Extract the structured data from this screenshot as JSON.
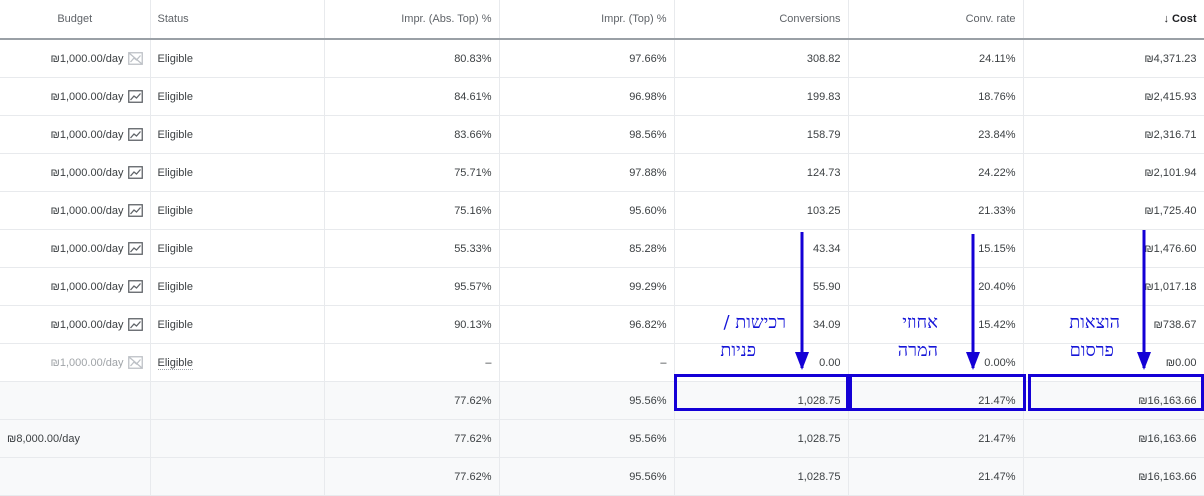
{
  "headers": {
    "budget": "Budget",
    "status": "Status",
    "impr_abs_top": "Impr. (Abs. Top) %",
    "impr_top": "Impr. (Top) %",
    "conversions": "Conversions",
    "conv_rate": "Conv. rate",
    "cost": "Cost",
    "cost_sort_icon": "↓"
  },
  "rows": [
    {
      "budget": "₪1,000.00/day",
      "chart": "paused",
      "status": "Eligible",
      "abs": "80.83%",
      "top": "97.66%",
      "conv": "308.82",
      "rate": "24.11%",
      "cost": "₪4,371.23"
    },
    {
      "budget": "₪1,000.00/day",
      "chart": "trend",
      "status": "Eligible",
      "abs": "84.61%",
      "top": "96.98%",
      "conv": "199.83",
      "rate": "18.76%",
      "cost": "₪2,415.93"
    },
    {
      "budget": "₪1,000.00/day",
      "chart": "trend",
      "status": "Eligible",
      "abs": "83.66%",
      "top": "98.56%",
      "conv": "158.79",
      "rate": "23.84%",
      "cost": "₪2,316.71"
    },
    {
      "budget": "₪1,000.00/day",
      "chart": "trend",
      "status": "Eligible",
      "abs": "75.71%",
      "top": "97.88%",
      "conv": "124.73",
      "rate": "24.22%",
      "cost": "₪2,101.94"
    },
    {
      "budget": "₪1,000.00/day",
      "chart": "trend",
      "status": "Eligible",
      "abs": "75.16%",
      "top": "95.60%",
      "conv": "103.25",
      "rate": "21.33%",
      "cost": "₪1,725.40"
    },
    {
      "budget": "₪1,000.00/day",
      "chart": "trend",
      "status": "Eligible",
      "abs": "55.33%",
      "top": "85.28%",
      "conv": "43.34",
      "rate": "15.15%",
      "cost": "₪1,476.60"
    },
    {
      "budget": "₪1,000.00/day",
      "chart": "trend",
      "status": "Eligible",
      "abs": "95.57%",
      "top": "99.29%",
      "conv": "55.90",
      "rate": "20.40%",
      "cost": "₪1,017.18"
    },
    {
      "budget": "₪1,000.00/day",
      "chart": "trend",
      "status": "Eligible",
      "abs": "90.13%",
      "top": "96.82%",
      "conv": "34.09",
      "rate": "15.42%",
      "cost": "₪738.67"
    },
    {
      "budget": "₪1,000.00/day",
      "chart": "paused",
      "status": "Eligible",
      "abs": "–",
      "top": "–",
      "conv": "0.00",
      "rate": "0.00%",
      "cost": "₪0.00",
      "dim": true
    }
  ],
  "summaries": [
    {
      "budget": "",
      "abs": "77.62%",
      "top": "95.56%",
      "conv": "1,028.75",
      "rate": "21.47%",
      "cost": "₪16,163.66"
    },
    {
      "budget": "₪8,000.00/day",
      "abs": "77.62%",
      "top": "95.56%",
      "conv": "1,028.75",
      "rate": "21.47%",
      "cost": "₪16,163.66"
    },
    {
      "budget": "",
      "abs": "77.62%",
      "top": "95.56%",
      "conv": "1,028.75",
      "rate": "21.47%",
      "cost": "₪16,163.66"
    }
  ],
  "annotations": {
    "conversions_line1": "רכישות /",
    "conversions_line2": "פניות",
    "rate_line1": "אחוזי",
    "rate_line2": "המרה",
    "cost_line1": "הוצאות",
    "cost_line2": "פרסום",
    "color": "#1400d6"
  }
}
